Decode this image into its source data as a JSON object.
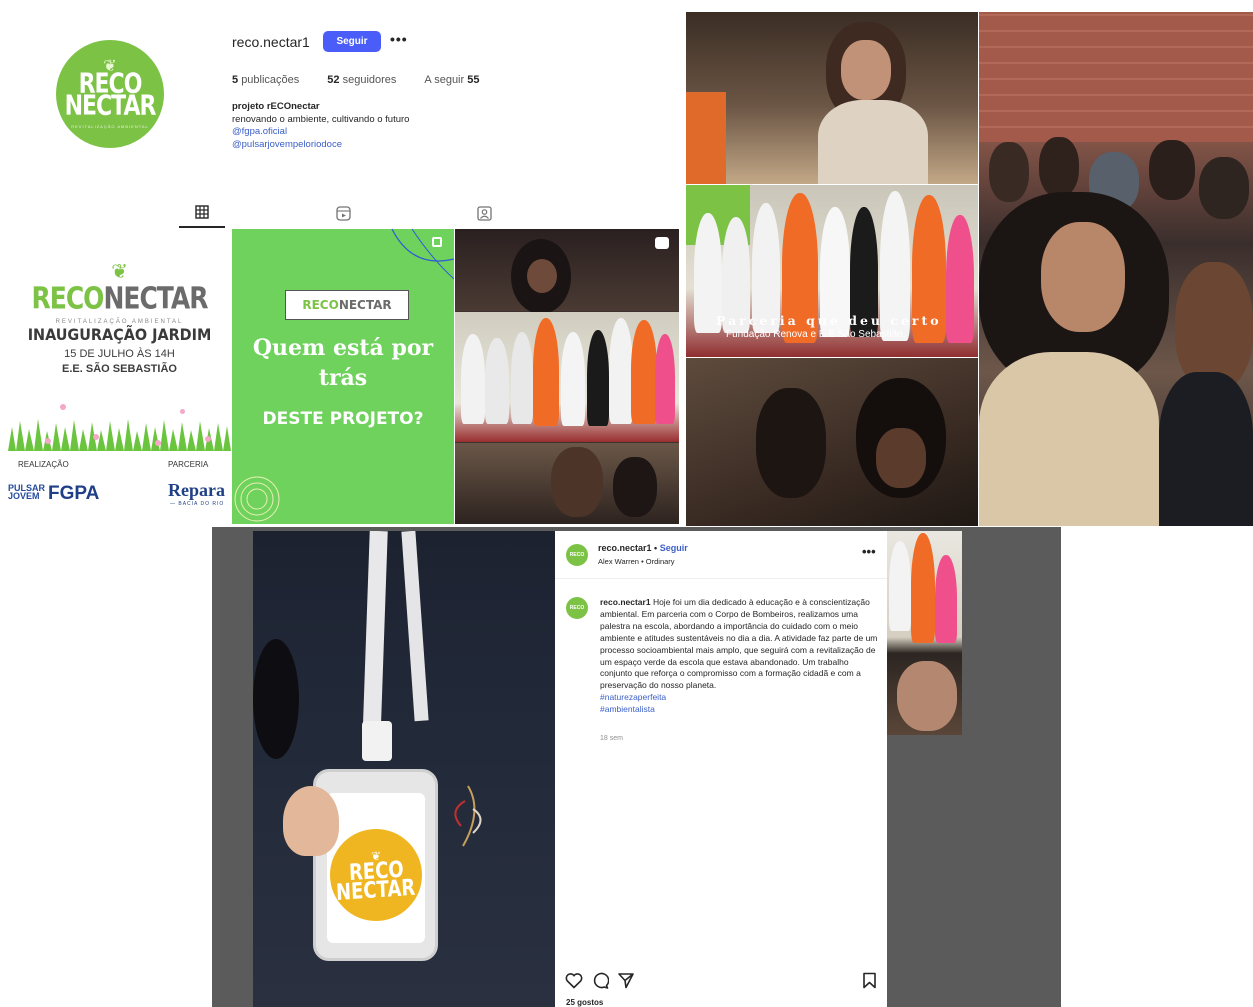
{
  "profile": {
    "avatar_line1": "RECO",
    "avatar_line2": "NECTAR",
    "avatar_sub": "REVITALIZAÇÃO AMBIENTAL",
    "username": "reco.nectar1",
    "follow_label": "Seguir",
    "more_label": "•••",
    "posts_count": "5",
    "posts_label": "publicações",
    "followers_count": "52",
    "followers_label": "seguidores",
    "following_label": "A seguir",
    "following_count": "55",
    "bio_name": "projeto rECOnectar",
    "bio_text": "renovando o ambiente, cultivando o futuro",
    "bio_link1": "@fgpa.oficial",
    "bio_link2": "@pulsarjovempeloriodoce"
  },
  "grid": {
    "post1": {
      "logo_a": "RECO",
      "logo_b": "NECTAR",
      "logo_sub": "REVITALIZAÇÃO AMBIENTAL",
      "heading": "INAUGURAÇÃO JARDIM",
      "date": "15 DE JULHO ÀS 14H",
      "place": "E.E. SÃO SEBASTIÃO",
      "realizacao": "REALIZAÇÃO",
      "parceria": "PARCERIA",
      "pulsar": "PULSAR JOVEM",
      "fgpa": "FGPA",
      "repara": "Repara",
      "repara_sub": "— BACIA DO RIO"
    },
    "post2": {
      "box_a": "RECO",
      "box_b": "NECTAR",
      "question_line1": "Quem está por",
      "question_line2": "trás",
      "question_line3": "DESTE PROJETO?"
    }
  },
  "video": {
    "caption_title": "Parceria que deu certo",
    "caption_sub": "Fundação Renova e E.E São Sebastião."
  },
  "post": {
    "username": "reco.nectar1",
    "separator": "•",
    "follow_label": "Seguir",
    "music": "Alex Warren • Ordinary",
    "more_label": "•••",
    "caption_user": "reco.nectar1",
    "caption_text": "Hoje foi um dia dedicado à educação e à conscientização ambiental. Em parceria com o Corpo de Bombeiros, realizamos uma palestra na escola, abordando a importância do cuidado com o meio ambiente e atitudes sustentáveis no dia a dia. A atividade faz parte de um processo socioambiental mais amplo, que seguirá com a revitalização de um espaço verde da escola que estava abandonado. Um trabalho conjunto que reforça o compromisso com a formação cidadã e com a preservação do nosso planeta.",
    "hashtag1": "#naturezaperfeita",
    "hashtag2": "#ambientalista",
    "time": "18 sem",
    "likes": "25 gostos",
    "badge_line1": "RECO",
    "badge_line2": "NECTAR"
  },
  "colors": {
    "brand_green": "#7cc245",
    "follow_blue": "#4a5df9",
    "link_blue": "#3b5fc7",
    "badge_yellow": "#f0b622"
  }
}
